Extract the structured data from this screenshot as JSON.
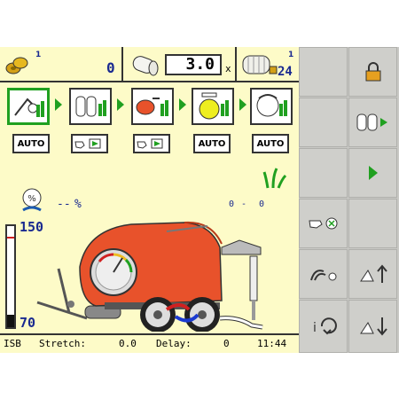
{
  "header": {
    "bales_counter": "1",
    "bales_value": "0",
    "rolls_value": "3.0",
    "rolls_unit": "x",
    "film_counter": "1",
    "film_value": "24"
  },
  "steps": [
    {
      "mode": "AUTO"
    },
    {
      "mode": ""
    },
    {
      "mode": ""
    },
    {
      "mode": "AUTO"
    },
    {
      "mode": "AUTO"
    }
  ],
  "moisture": {
    "value": "--",
    "unit": "%"
  },
  "pressure_range": {
    "low": "0",
    "sep": "-",
    "high": "0"
  },
  "gauge": {
    "top": "150",
    "bottom": "70",
    "level": 0.12
  },
  "status": {
    "left": "ISB",
    "stretch_label": "Stretch:",
    "stretch_value": "0.0",
    "delay_label": "Delay:",
    "delay_value": "0",
    "time": "11:44"
  },
  "softkeys": [
    {
      "icon": "lock-icon"
    },
    {
      "icon": "film-rolls-icon"
    },
    {
      "icon": "play-arrow-icon"
    },
    {
      "icon": "manual-hand-icon"
    },
    {
      "icon": "knife-icon"
    },
    {
      "icon": "pedal-up-icon"
    },
    {
      "icon": "info-cycle-icon"
    },
    {
      "icon": "pedal-down-icon"
    }
  ],
  "colors": {
    "accent_green": "#20a020",
    "baler_orange": "#e8522b",
    "panel_bg": "#fdfbc8"
  }
}
